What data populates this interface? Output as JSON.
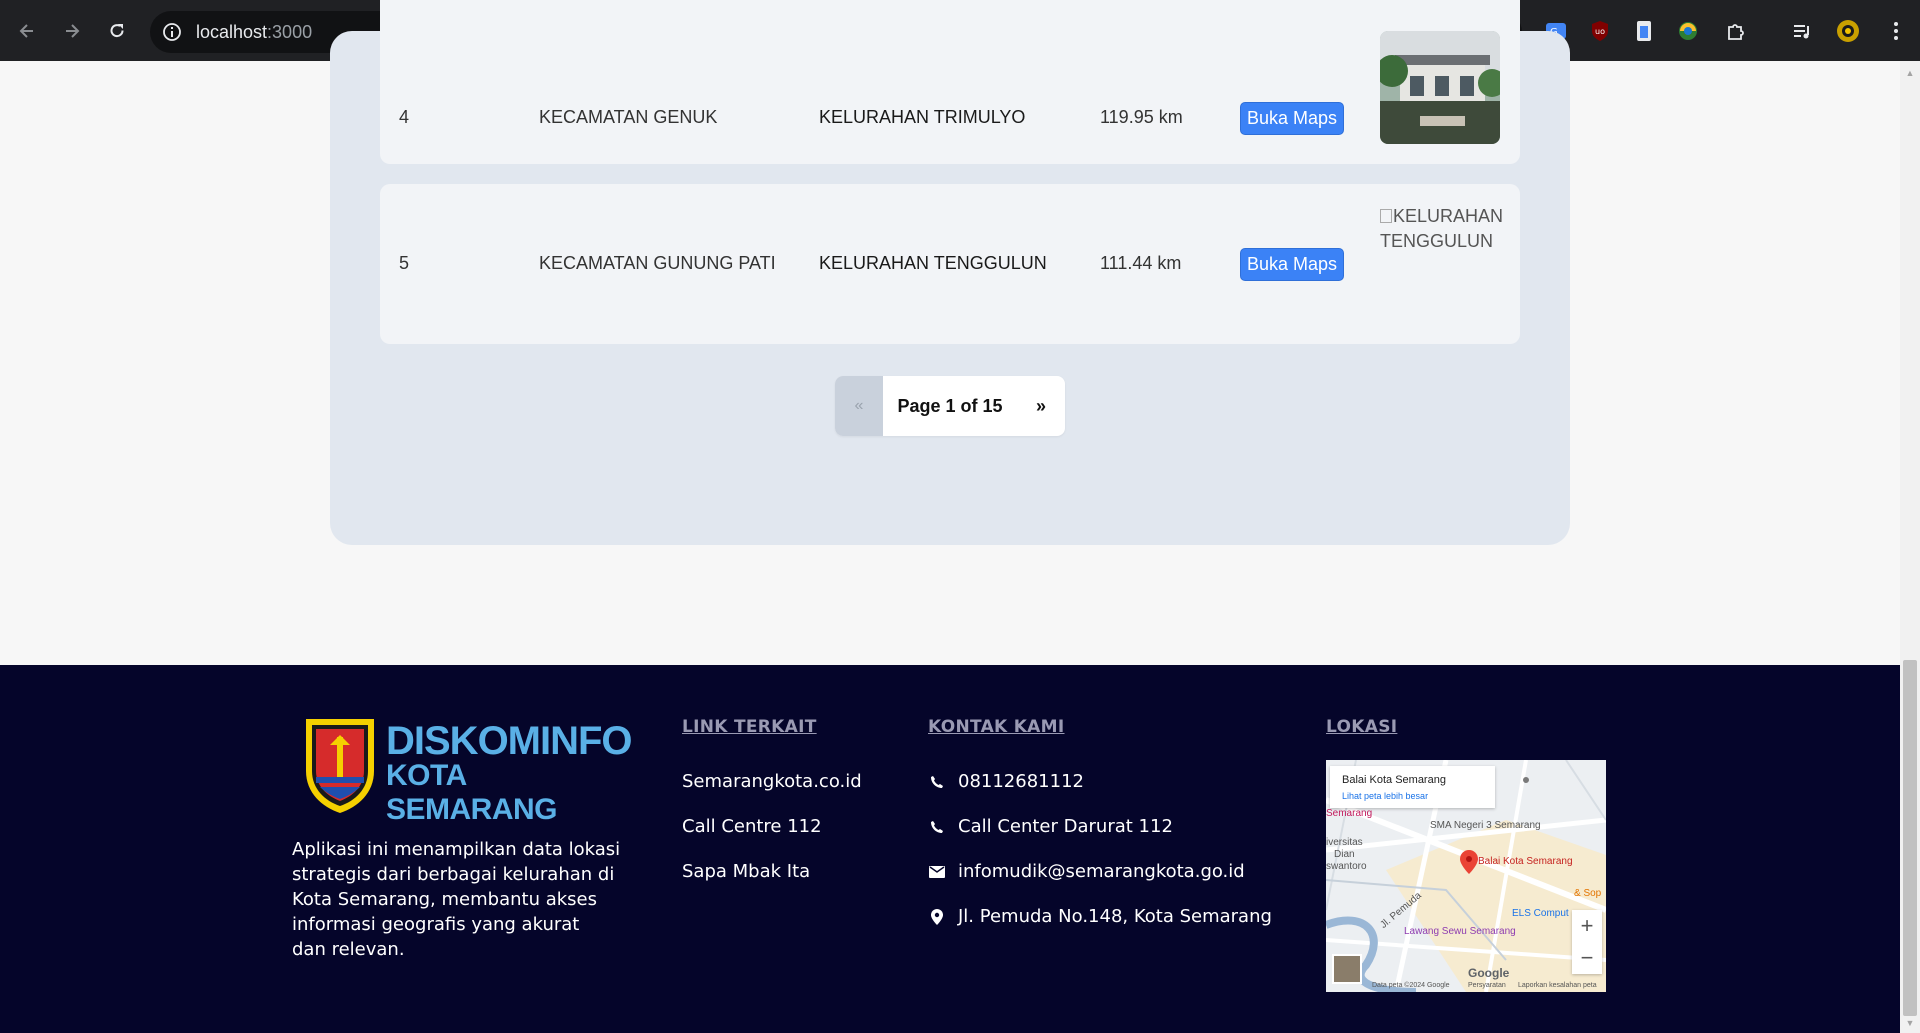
{
  "browser": {
    "url_host": "localhost",
    "url_port": ":3000"
  },
  "table": {
    "rows": [
      {
        "no": "4",
        "kecamatan": "KECAMATAN GENUK",
        "kelurahan": "KELURAHAN TRIMULYO",
        "distance": "119.95 km",
        "maps_label": "Buka Maps",
        "image_alt": "KELURAHAN TRIMULYO"
      },
      {
        "no": "5",
        "kecamatan": "KECAMATAN GUNUNG PATI",
        "kelurahan": "KELURAHAN TENGGULUN",
        "distance": "111.44 km",
        "maps_label": "Buka Maps",
        "image_alt_line1": "KELURAHAN",
        "image_alt_line2": "TENGGULUN"
      }
    ]
  },
  "pagination": {
    "prev": "«",
    "label": "Page 1 of 15",
    "next": "»"
  },
  "footer": {
    "logo_line1": "DISKOMINFO",
    "logo_line2": "KOTA SEMARANG",
    "about_lines": [
      "Aplikasi ini menampilkan data lokasi",
      "strategis dari berbagai kelurahan di",
      "Kota Semarang, membantu akses",
      "informasi geografis yang akurat",
      "dan relevan."
    ],
    "links_title": "LINK TERKAIT",
    "links": [
      "Semarangkota.co.id",
      "Call Centre 112",
      "Sapa Mbak Ita"
    ],
    "contact_title": "KONTAK KAMI",
    "contacts": [
      {
        "icon": "phone-icon",
        "text": "08112681112"
      },
      {
        "icon": "phone-icon",
        "text": "Call Center Darurat 112"
      },
      {
        "icon": "mail-icon",
        "text": "infomudik@semarangkota.go.id"
      },
      {
        "icon": "location-pin-icon",
        "text": "Jl. Pemuda No.148, Kota Semarang"
      }
    ],
    "location_title": "LOKASI",
    "map": {
      "place": "Balai Kota Semarang",
      "view_larger": "Lihat peta lebih besar",
      "labels": [
        "SMA Negeri 3 Semarang",
        "Balai Kota Semarang",
        "Lawang Sewu Semarang",
        "ELS Comput",
        "Jl. Pemuda",
        "iversitas",
        "Dian",
        "swantoro",
        "Semarang",
        "& Sop",
        "Google",
        "Data peta ©2024 Google",
        "Persyaratan",
        "Laporkan kesalahan peta"
      ],
      "zoom_in": "+",
      "zoom_out": "−"
    }
  }
}
